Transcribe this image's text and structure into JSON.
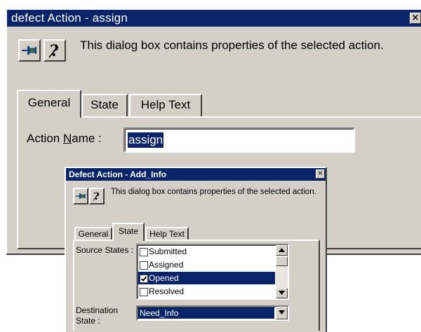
{
  "outer": {
    "title": "defect Action - assign",
    "close_glyph": "×",
    "description": "This dialog box contains properties of the selected action.",
    "tabs": [
      "General",
      "State",
      "Help Text"
    ],
    "active_tab": "General",
    "action_name_label_pre": "Action ",
    "action_name_label_key": "N",
    "action_name_label_post": "ame :",
    "action_name_value": "assign"
  },
  "inner": {
    "title": "Defect Action - Add_Info",
    "close_glyph": "×",
    "description": "This dialog box contains properties of the selected action.",
    "tabs": [
      "General",
      "State",
      "Help Text"
    ],
    "active_tab": "State",
    "source_states_label": "Source States :",
    "source_states": [
      {
        "label": "Submitted",
        "checked": false,
        "selected": false
      },
      {
        "label": "Assigned",
        "checked": false,
        "selected": false
      },
      {
        "label": "Opened",
        "checked": true,
        "selected": true
      },
      {
        "label": "Resolved",
        "checked": false,
        "selected": false
      }
    ],
    "destination_label_line1": "Destination",
    "destination_label_line2": "State :",
    "destination_value": "Need_Info"
  },
  "icons": {
    "pin": "pin-icon",
    "help": "help-question-icon",
    "close": "close-icon",
    "scroll_up": "scroll-up-arrow-icon",
    "scroll_down": "scroll-down-arrow-icon",
    "dropdown": "dropdown-arrow-icon"
  },
  "colors": {
    "titlebar": "#0a246a",
    "face": "#d4d0c8",
    "selection": "#0a246a"
  }
}
